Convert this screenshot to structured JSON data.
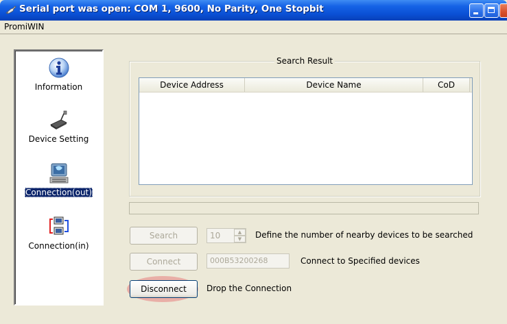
{
  "window": {
    "title": "Serial port was open: COM 1, 9600, No Parity, One Stopbit",
    "title_icon": "plug-icon",
    "controls": [
      "minimize",
      "maximize",
      "close"
    ],
    "accent": "#0a4fd4"
  },
  "menu": {
    "items": [
      "PromiWIN"
    ]
  },
  "sidebar": {
    "items": [
      {
        "label": "Information",
        "icon": "info-icon",
        "selected": false
      },
      {
        "label": "Device Setting",
        "icon": "device-icon",
        "selected": false
      },
      {
        "label": "Connection(out)",
        "icon": "connection-out-icon",
        "selected": true
      },
      {
        "label": "Connection(in)",
        "icon": "connection-in-icon",
        "selected": false
      }
    ]
  },
  "search_result": {
    "title": "Search Result",
    "columns": [
      "Device Address",
      "Device Name",
      "CoD"
    ],
    "rows": []
  },
  "search": {
    "button_label": "Search",
    "count_value": "10",
    "description": "Define the number of nearby devices to be searched"
  },
  "connect": {
    "button_label": "Connect",
    "address_value": "000B53200268",
    "description": "Connect to Specified devices"
  },
  "disconnect": {
    "button_label": "Disconnect",
    "description": "Drop the Connection",
    "highlight_color": "#e78080"
  }
}
